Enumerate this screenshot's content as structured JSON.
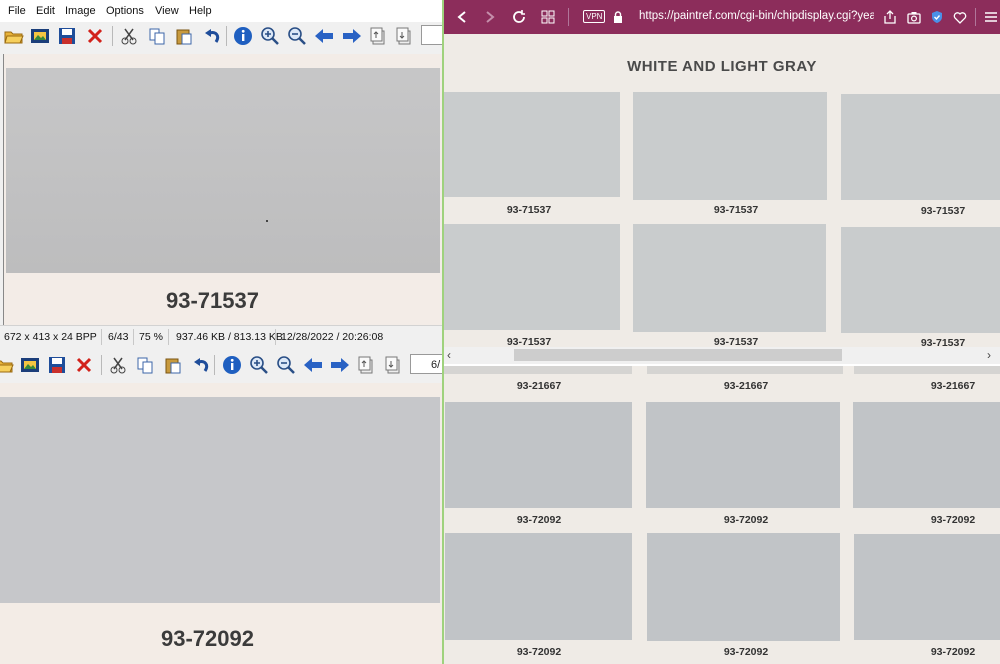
{
  "viewer": {
    "menu": [
      "File",
      "Edit",
      "Image",
      "Options",
      "View",
      "Help"
    ],
    "toolbar_icons": [
      "open-folder-icon",
      "slideshow-icon",
      "save-icon",
      "delete-icon",
      "cut-icon",
      "copy-icon",
      "paste-icon",
      "undo-icon",
      "info-icon",
      "zoom-in-icon",
      "zoom-out-icon",
      "prev-arrow-icon",
      "next-arrow-icon",
      "first-page-icon",
      "last-page-icon"
    ],
    "top_chip_number": "93-71537",
    "bottom_chip_number": "93-72092",
    "bottom_page_field": "6/",
    "status": {
      "dimensions": "672 x 413 x 24 BPP",
      "index": "6/43",
      "zoom": "75 %",
      "size": "937.46 KB / 813.13 KB",
      "datetime": "12/28/2022 / 20:26:08"
    }
  },
  "browser": {
    "url": "https://paintref.com/cgi-bin/chipdisplay.cgi?yea",
    "vpn_label": "VPN",
    "page_title": "WHITE AND LIGHT GRAY",
    "row1_labels": [
      "93-71537",
      "93-71537",
      "93-71537"
    ],
    "row2_labels": [
      "93-71537",
      "93-71537",
      "93-71537"
    ]
  },
  "browser_lower": {
    "row0_labels": [
      "93-21667",
      "93-21667",
      "93-21667"
    ],
    "row1_labels": [
      "93-72092",
      "93-72092",
      "93-72092"
    ],
    "row2_labels": [
      "93-72092",
      "93-72092",
      "93-72092"
    ]
  },
  "colors": {
    "browser_nav": "#8c2d5b",
    "chip_light_gray": "#c9cccd",
    "chip_72092": "#c1c4c7",
    "viewer_chip_top": "#c3c3c4",
    "viewer_chip_bottom": "#c6c7ca",
    "divider_green": "#9fd27d"
  }
}
